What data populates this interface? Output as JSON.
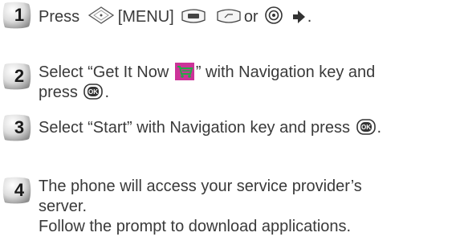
{
  "steps": [
    {
      "number": "1",
      "press": "Press",
      "menu": "[MENU]",
      "or": "or",
      "end": "."
    },
    {
      "number": "2",
      "line1_start": "Select “Get It Now",
      "line1_end": "” with Navigation key and",
      "line2_start": "press",
      "line2_end": "."
    },
    {
      "number": "3",
      "text_start": "Select “Start” with Navigation key and press",
      "text_end": "."
    },
    {
      "number": "4",
      "line1": "The phone will access your service provider’s",
      "line2": "server.",
      "line3": "Follow the prompt to download applications."
    }
  ],
  "icons": {
    "nav_key": "navigation-key-icon",
    "menu_key": "menu-key-icon",
    "soft_key": "soft-key-icon",
    "ok_key": "ok-key-icon",
    "arrow": "right-arrow-icon",
    "cart": "shopping-cart-icon"
  },
  "colors": {
    "badge_light": "#eeeeee",
    "badge_dark": "#9a9a9a",
    "cart_bg": "#cc3399",
    "cart_fg": "#22aa44"
  }
}
